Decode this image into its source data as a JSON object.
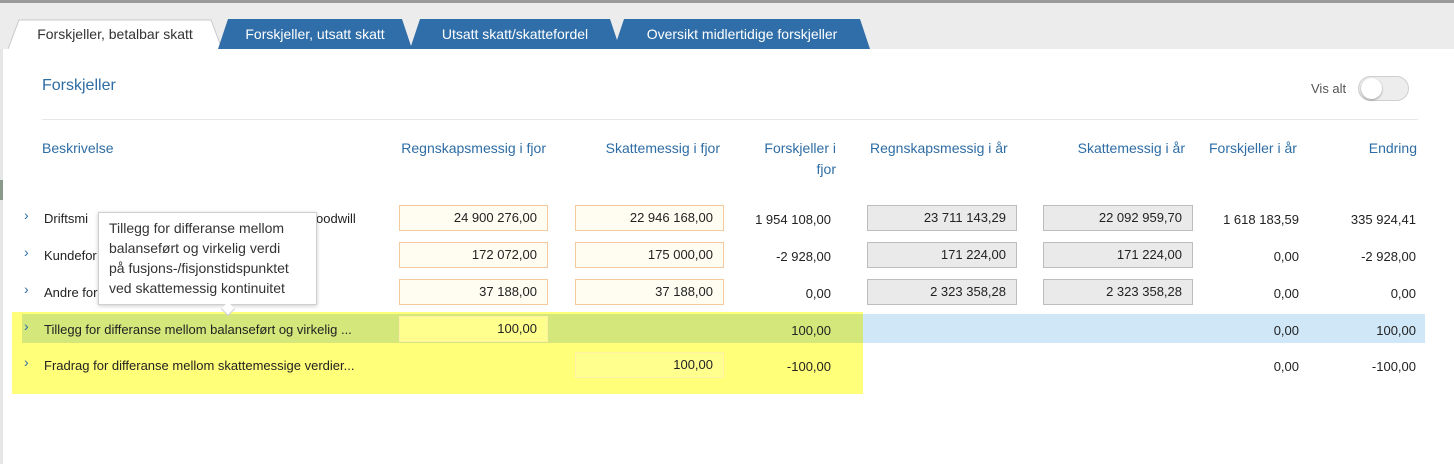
{
  "tabs": [
    {
      "label": "Forskjeller, betalbar skatt",
      "active": true
    },
    {
      "label": "Forskjeller, utsatt skatt",
      "active": false
    },
    {
      "label": "Utsatt skatt/skattefordel",
      "active": false
    },
    {
      "label": "Oversikt midlertidige forskjeller",
      "active": false
    }
  ],
  "section": {
    "title": "Forskjeller",
    "vis_alt_label": "Vis alt",
    "vis_alt_on": false
  },
  "columns": {
    "beskrivelse": "Beskrivelse",
    "regnskap_fjor": "Regnskapsmessig i fjor",
    "skatt_fjor": "Skattemessig i fjor",
    "forskjeller_fjor_line1": "Forskjeller i",
    "forskjeller_fjor_line2": "fjor",
    "regnskap_aar": "Regnskapsmessig i år",
    "skatt_aar": "Skattemessig i år",
    "forskjeller_aar": "Forskjeller i år",
    "endring": "Endring"
  },
  "rows": [
    {
      "desc_start": "Driftsmi",
      "desc_end": "oodwill",
      "regnskap_fjor": "24 900 276,00",
      "skatt_fjor": "22 946 168,00",
      "forskjeller_fjor": "1 954 108,00",
      "regnskap_aar": "23 711 143,29",
      "skatt_aar": "22 092 959,70",
      "forskjeller_aar": "1 618 183,59",
      "endring": "335 924,41"
    },
    {
      "desc_start": "Kundefor",
      "regnskap_fjor": "172 072,00",
      "skatt_fjor": "175 000,00",
      "forskjeller_fjor": "-2 928,00",
      "regnskap_aar": "171 224,00",
      "skatt_aar": "171 224,00",
      "forskjeller_aar": "0,00",
      "endring": "-2 928,00"
    },
    {
      "desc_start": "Andre for",
      "regnskap_fjor": "37 188,00",
      "skatt_fjor": "37 188,00",
      "forskjeller_fjor": "0,00",
      "regnskap_aar": "2 323 358,28",
      "skatt_aar": "2 323 358,28",
      "forskjeller_aar": "0,00",
      "endring": "0,00"
    },
    {
      "desc": "Tillegg for differanse mellom balanseført og virkelig ...",
      "regnskap_fjor": "100,00",
      "forskjeller_fjor": "100,00",
      "forskjeller_aar": "0,00",
      "endring": "100,00"
    },
    {
      "desc": "Fradrag for differanse mellom skattemessige verdier...",
      "skatt_fjor": "100,00",
      "forskjeller_fjor": "-100,00",
      "forskjeller_aar": "0,00",
      "endring": "-100,00"
    }
  ],
  "tooltip": {
    "line1": "Tillegg for differanse mellom",
    "line2": "balanseført og virkelig verdi",
    "line3": "på fusjons-/fisjonstidspunktet",
    "line4": "ved skattemessig kontinuitet"
  },
  "icons": {
    "expand": "chevron-right-icon"
  },
  "colors": {
    "accent": "#2e6da4",
    "tab_inactive": "#2f6ea8",
    "highlight_yellow": "#ffff7a",
    "highlight_green": "#d4e77a",
    "highlight_blue": "#cfe7f7"
  }
}
